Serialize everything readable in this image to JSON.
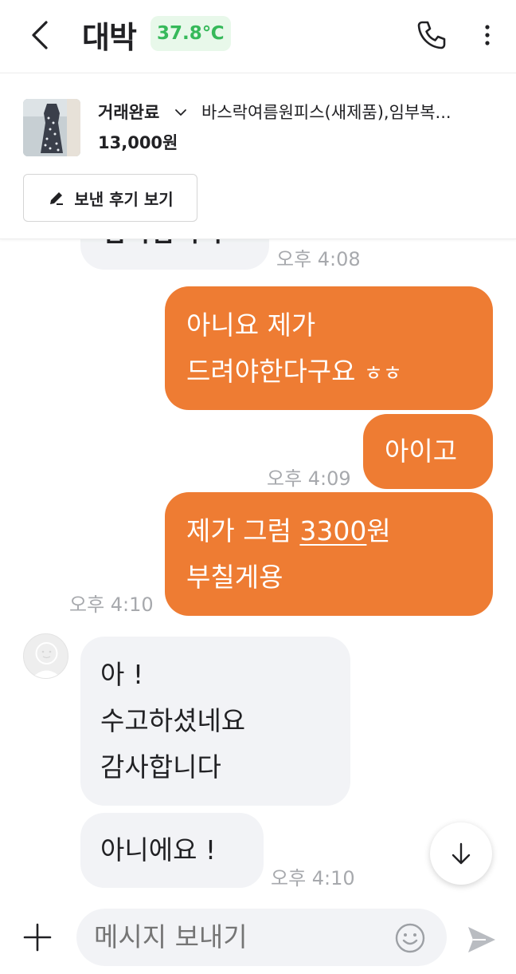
{
  "header": {
    "title": "대박",
    "temperature": "37.8℃"
  },
  "product": {
    "status": "거래완료",
    "name": "바스락여름원피스(새제품),임부복...",
    "price": "13,000원",
    "review_button_label": "보낸 후기 보기"
  },
  "messages": [
    {
      "sender": "other",
      "partial_text": "감사합니다",
      "time": "오후 4:08"
    },
    {
      "sender": "me",
      "lines": [
        "아니요 제가",
        "드려야한다구요"
      ],
      "suffix": "ㅎㅎ"
    },
    {
      "sender": "me",
      "lines": [
        "아이고"
      ],
      "time": "오후 4:09"
    },
    {
      "sender": "me",
      "lines_pre": "제가 그럼 ",
      "underlined": "3300",
      "lines_post": "원",
      "line2": "부칠게용",
      "time": "오후 4:10"
    },
    {
      "sender": "other",
      "lines": [
        "아 !",
        "수고하셨네요",
        "감사합니다"
      ]
    },
    {
      "sender": "other",
      "lines": [
        "아니에요 !"
      ],
      "time": "오후 4:10"
    }
  ],
  "composer": {
    "placeholder": "메시지 보내기"
  },
  "icons": {
    "back": "back-arrow-icon",
    "call": "phone-icon",
    "more": "more-vertical-icon",
    "caret": "chevron-down-icon",
    "pencil": "pencil-icon",
    "scroll": "arrow-down-icon",
    "plus": "plus-icon",
    "emoji": "smiley-icon",
    "send": "send-icon"
  },
  "colors": {
    "accent": "#ee7c33",
    "temperature_bg": "#e8f8ea",
    "temperature_fg": "#36b95a",
    "bubble_other": "#f2f3f6"
  }
}
